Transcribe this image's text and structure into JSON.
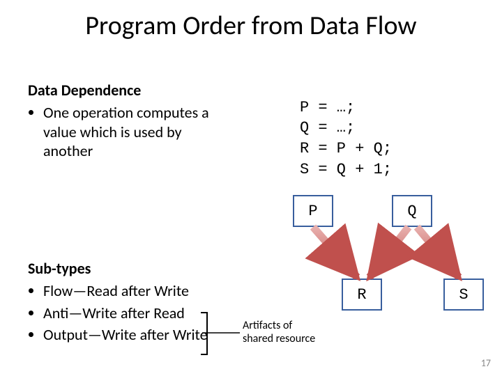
{
  "title": "Program Order from Data Flow",
  "dep": {
    "heading": "Data Dependence",
    "bullet": "One operation computes a value which is used by another"
  },
  "code": {
    "l1": "P = …;",
    "l2": "Q = …;",
    "l3": "R = P + Q;",
    "l4": "S = Q + 1;"
  },
  "nodes": {
    "P": "P",
    "Q": "Q",
    "R": "R",
    "S": "S"
  },
  "sub": {
    "heading": "Sub-types",
    "b1": "Flow—Read after Write",
    "b2": "Anti—Write after Read",
    "b3": "Output—Write after Write"
  },
  "caption": {
    "l1": "Artifacts of",
    "l2": "shared resource"
  },
  "pagenum": "17"
}
